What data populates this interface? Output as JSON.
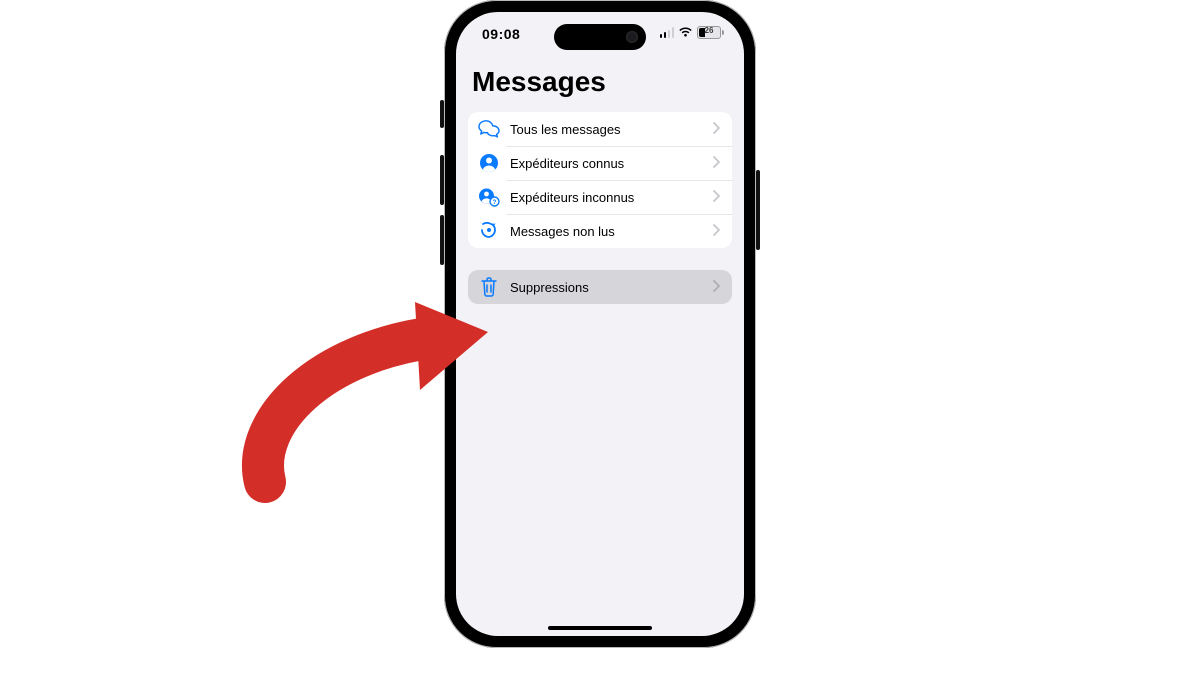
{
  "statusbar": {
    "time": "09:08",
    "battery_percent": "26",
    "signal_bars_active": 2,
    "signal_bars_total": 4
  },
  "page": {
    "title": "Messages"
  },
  "filters": [
    {
      "id": "all",
      "label": "Tous les messages",
      "icon": "chat-bubbles-icon"
    },
    {
      "id": "known",
      "label": "Expéditeurs connus",
      "icon": "person-circle-icon"
    },
    {
      "id": "unknown",
      "label": "Expéditeurs inconnus",
      "icon": "person-unknown-icon"
    },
    {
      "id": "unread",
      "label": "Messages non lus",
      "icon": "refresh-bubble-icon"
    }
  ],
  "deleted": {
    "label": "Suppressions",
    "icon": "trash-icon",
    "highlighted": true
  },
  "annotation": {
    "arrow_color": "#d42e28"
  }
}
